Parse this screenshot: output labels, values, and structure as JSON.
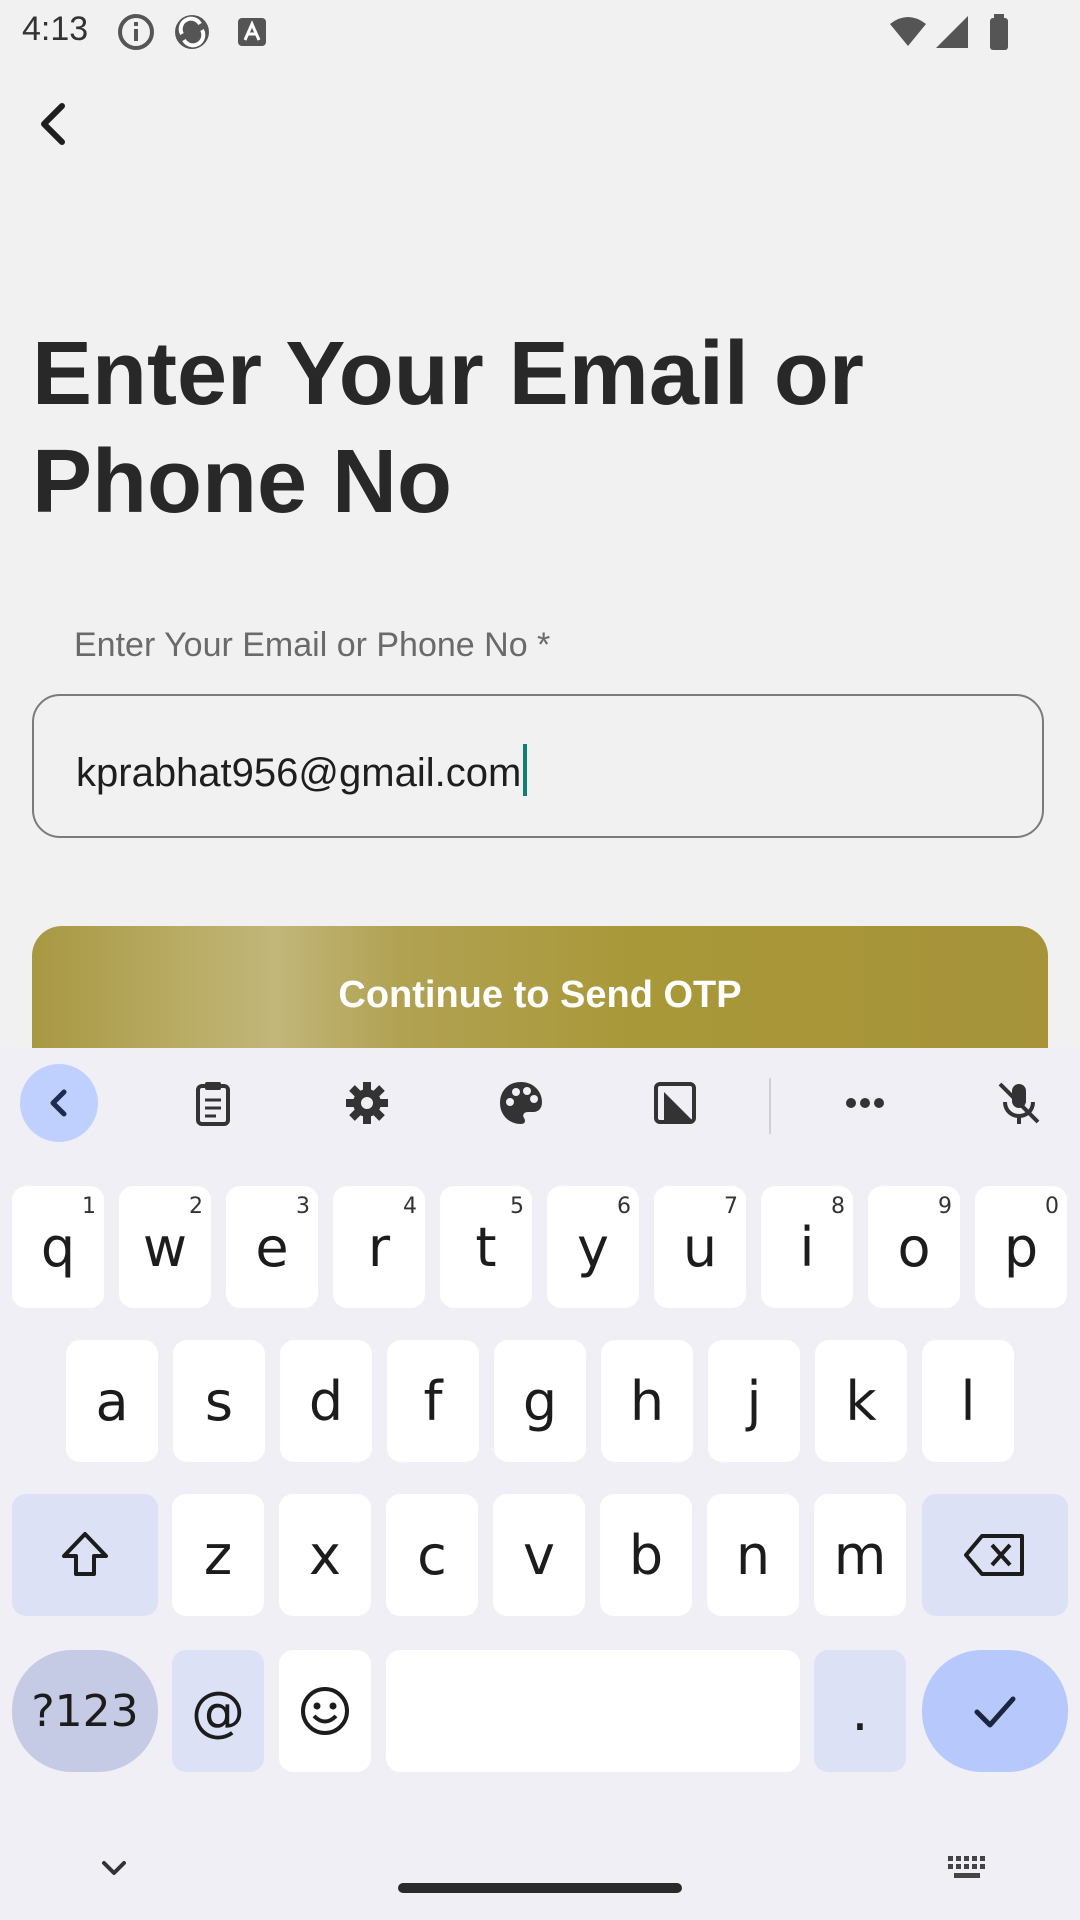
{
  "status_bar": {
    "time": "4:13"
  },
  "page": {
    "title": "Enter Your Email or Phone No",
    "field_label": "Enter Your Email or Phone No *",
    "field_value": "kprabhat956@gmail.com",
    "cta_label": "Continue to Send OTP"
  },
  "keyboard": {
    "row1": [
      {
        "k": "q",
        "h": "1"
      },
      {
        "k": "w",
        "h": "2"
      },
      {
        "k": "e",
        "h": "3"
      },
      {
        "k": "r",
        "h": "4"
      },
      {
        "k": "t",
        "h": "5"
      },
      {
        "k": "y",
        "h": "6"
      },
      {
        "k": "u",
        "h": "7"
      },
      {
        "k": "i",
        "h": "8"
      },
      {
        "k": "o",
        "h": "9"
      },
      {
        "k": "p",
        "h": "0"
      }
    ],
    "row2": [
      "a",
      "s",
      "d",
      "f",
      "g",
      "h",
      "j",
      "k",
      "l"
    ],
    "row3": [
      "z",
      "x",
      "c",
      "v",
      "b",
      "n",
      "m"
    ],
    "sym_label": "?123",
    "at_label": "@",
    "period_label": "."
  },
  "colors": {
    "accent_gold": "#a99838",
    "caret": "#0f7f72",
    "keyboard_bg": "#f0eff6",
    "enter_key": "#b7c8fc"
  }
}
